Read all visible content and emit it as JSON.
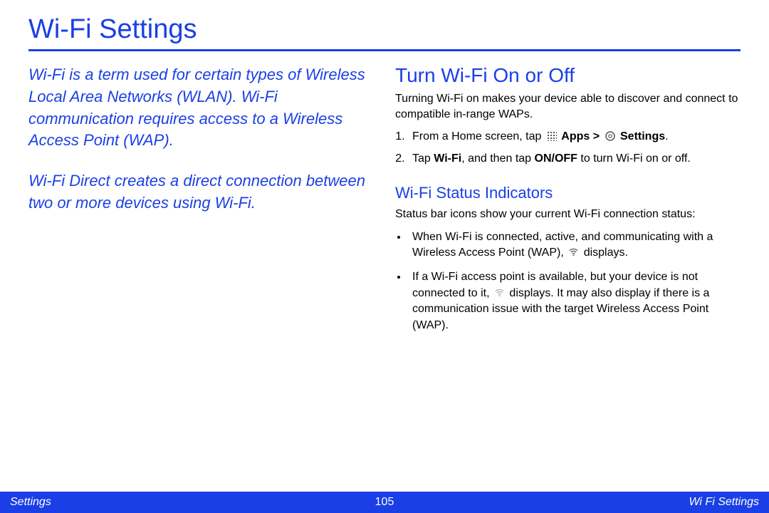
{
  "title": "Wi-Fi Settings",
  "intro": {
    "p1": "Wi-Fi is a term used for certain types of Wireless Local Area Networks (WLAN). Wi-Fi communication requires access to a Wireless Access Point (WAP).",
    "p2": "Wi-Fi Direct creates a direct connection between two or more devices using Wi-Fi."
  },
  "section1": {
    "heading": "Turn Wi-Fi On or Off",
    "intro": "Turning Wi-Fi on makes your device able to discover and connect to compatible in-range WAPs.",
    "step1_a": "From a Home screen, tap ",
    "step1_apps": "Apps",
    "step1_gt": " > ",
    "step1_settings": "Settings",
    "step1_end": ".",
    "step2_a": "Tap ",
    "step2_wifi": "Wi-Fi",
    "step2_b": ", and then tap ",
    "step2_onoff": "ON/OFF",
    "step2_c": " to turn Wi-Fi on or off."
  },
  "section2": {
    "heading": "Wi-Fi Status Indicators",
    "intro": "Status bar icons show your current Wi-Fi connection status:",
    "bul1_a": "When Wi-Fi is connected, active, and communicating with a Wireless Access Point (WAP), ",
    "bul1_b": " displays.",
    "bul2_a": "If a Wi-Fi access point is available, but your device is not connected to it, ",
    "bul2_b": " displays. It may also display if there is a communication issue with the target Wireless Access Point (WAP)."
  },
  "footer": {
    "left": "Settings",
    "center": "105",
    "right": "Wi Fi Settings"
  }
}
